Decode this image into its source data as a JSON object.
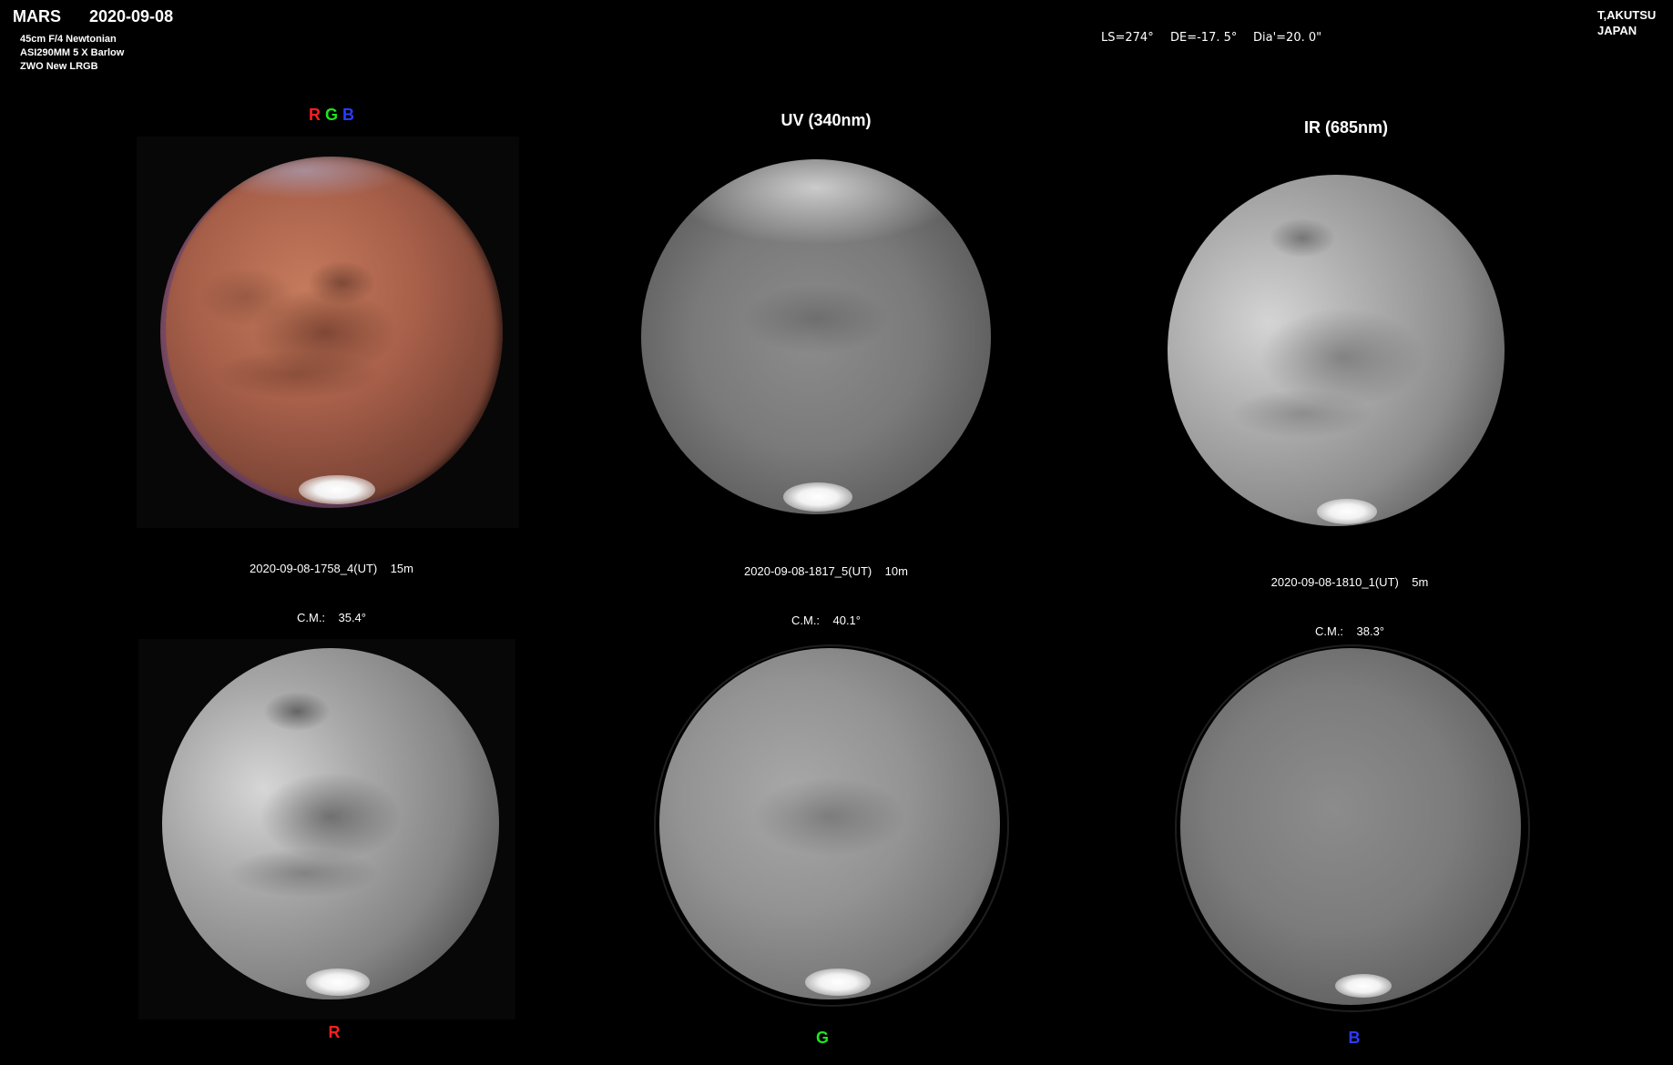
{
  "header": {
    "title": "MARS",
    "date": "2020-09-08",
    "equipment": [
      "45cm F/4  Newtonian",
      "ASI290MM    5 X  Barlow",
      "ZWO  New LRGB"
    ],
    "observation": {
      "ls": "LS=274°",
      "de": "DE=-17. 5°",
      "dia": "Dia'=20. 0\""
    },
    "author": [
      "T,AKUTSU",
      "JAPAN"
    ]
  },
  "panels": {
    "rgb": {
      "label_r": "R",
      "label_g": "G",
      "label_b": "B",
      "caption_time": "2020-09-08-1758_4(UT)    15m",
      "caption_cm": "C.M.:    35.4°"
    },
    "uv": {
      "label": "UV (340nm)",
      "caption_time": "2020-09-08-1817_5(UT)    10m",
      "caption_cm": "C.M.:    40.1°"
    },
    "ir": {
      "label": "IR (685nm)",
      "caption_time": "2020-09-08-1810_1(UT)    5m",
      "caption_cm": "C.M.:    38.3°"
    },
    "r": {
      "label": "R"
    },
    "g": {
      "label": "G"
    },
    "b": {
      "label": "B"
    }
  },
  "colors": {
    "background": "#000000",
    "label_red": "#ff1e1e",
    "label_green": "#1ee61e",
    "label_blue": "#2a3cff",
    "mars_surface": "#a8604a"
  }
}
